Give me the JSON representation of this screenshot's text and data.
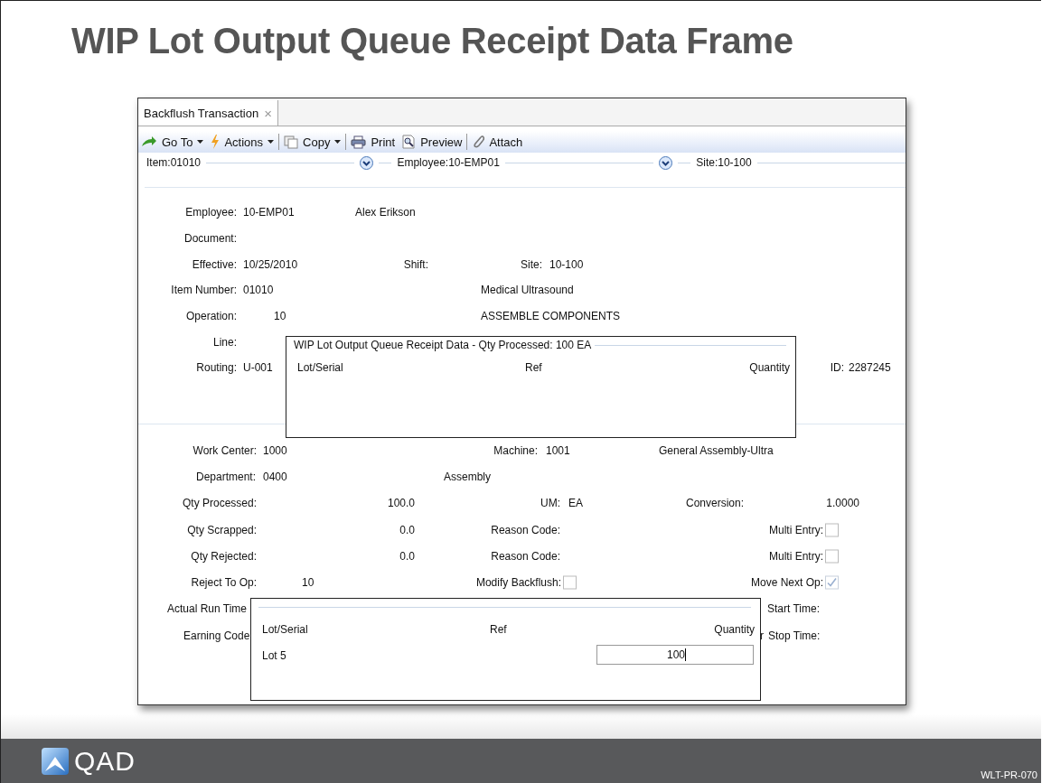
{
  "slide": {
    "title": "WIP Lot Output Queue Receipt Data Frame",
    "logo_text": "QAD",
    "code": "WLT-PR-070"
  },
  "window": {
    "tabs": [
      {
        "label": "Backflush Transaction",
        "selected": true,
        "close": "×"
      }
    ],
    "toolbar": [
      {
        "label": "Go To",
        "kind": "goto",
        "dropdown": true
      },
      {
        "label": "Actions",
        "kind": "actions",
        "dropdown": true
      },
      {
        "label": "Copy",
        "kind": "copy",
        "dropdown": true
      },
      {
        "label": "Print",
        "kind": "print",
        "dropdown": false
      },
      {
        "label": "Preview",
        "kind": "preview",
        "dropdown": false
      },
      {
        "label": "Attach",
        "kind": "attach",
        "dropdown": false
      }
    ],
    "filters": [
      {
        "text": "Item:01010",
        "expandable": true
      },
      {
        "text": "Employee:10-EMP01",
        "expandable": true
      },
      {
        "text": "Site:10-100",
        "expandable": false
      }
    ],
    "header_rows": [
      [
        {
          "kind": "field",
          "label": "Employee:",
          "value": "10-EMP01"
        },
        {
          "kind": "text",
          "text": "Alex Erikson"
        }
      ],
      [
        {
          "kind": "field",
          "label": "Document:"
        }
      ],
      [
        {
          "kind": "field",
          "label": "Effective:",
          "value": "10/25/2010"
        },
        {
          "kind": "field",
          "label": "Shift:"
        },
        {
          "kind": "field",
          "label": "Site:",
          "value": "10-100"
        }
      ],
      [
        {
          "kind": "field",
          "label": "Item Number:",
          "value": "01010"
        },
        {
          "kind": "text",
          "text": "Medical Ultrasound"
        }
      ],
      [
        {
          "kind": "field",
          "label": "Operation:",
          "value": "10"
        },
        {
          "kind": "text",
          "text": "ASSEMBLE COMPONENTS"
        }
      ],
      [
        {
          "kind": "field",
          "label": "Line:"
        }
      ],
      [
        {
          "kind": "field",
          "label": "Routing:",
          "value": "U-001"
        },
        {
          "kind": "field",
          "label": "ID:",
          "value": "2287245"
        }
      ]
    ],
    "detail_rows": [
      [
        {
          "kind": "field",
          "label": "Work Center:",
          "value": "1000"
        },
        {
          "kind": "field",
          "label": "Machine:",
          "value": "1001"
        },
        {
          "kind": "text",
          "text": "General Assembly-Ultra"
        }
      ],
      [
        {
          "kind": "field",
          "label": "Department:",
          "value": "0400"
        },
        {
          "kind": "text",
          "text": "Assembly"
        }
      ],
      [
        {
          "kind": "field",
          "label": "Qty Processed:",
          "value": "100.0"
        },
        {
          "kind": "field",
          "label": "UM:",
          "value": "EA"
        },
        {
          "kind": "field",
          "label": "Conversion:",
          "value": "1.0000"
        }
      ],
      [
        {
          "kind": "field",
          "label": "Qty Scrapped:",
          "value": "0.0"
        },
        {
          "kind": "field",
          "label": "Reason Code:"
        },
        {
          "kind": "checkbox",
          "label": "Multi Entry:",
          "checked": false
        }
      ],
      [
        {
          "kind": "field",
          "label": "Qty Rejected:",
          "value": "0.0"
        },
        {
          "kind": "field",
          "label": "Reason Code:"
        },
        {
          "kind": "checkbox",
          "label": "Multi Entry:",
          "checked": false
        }
      ],
      [
        {
          "kind": "field",
          "label": "Reject To Op:",
          "value": "10"
        },
        {
          "kind": "checkbox",
          "label": "Modify Backflush:",
          "checked": false
        },
        {
          "kind": "checkbox",
          "label": "Move Next Op:",
          "checked": true
        }
      ],
      [
        {
          "kind": "text",
          "text": "Actual Run Time"
        },
        {
          "kind": "text",
          "text": "Start Time:"
        }
      ],
      [
        {
          "kind": "text",
          "text": "Earning Code"
        },
        {
          "kind": "text",
          "text": "r"
        },
        {
          "kind": "text",
          "text": "Stop Time:"
        }
      ]
    ],
    "dialogs": [
      {
        "title": "WIP Lot Output Queue Receipt Data - Qty Processed: 100 EA",
        "columns": [
          "Lot/Serial",
          "Ref",
          "Quantity"
        ]
      },
      {
        "columns": [
          "Lot/Serial",
          "Ref",
          "Quantity"
        ],
        "rows": [
          {
            "lot": "Lot 5",
            "quantity": "100"
          }
        ]
      }
    ]
  }
}
